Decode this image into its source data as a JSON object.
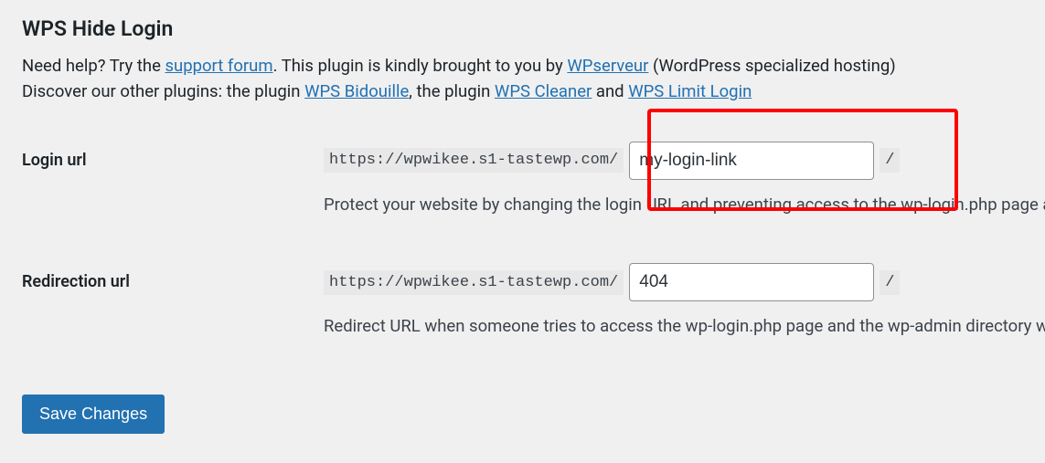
{
  "heading": "WPS Hide Login",
  "intro": {
    "help_prefix": "Need help? Try the ",
    "support_forum": "support forum",
    "brought_by_prefix": ". This plugin is kindly brought to you by ",
    "wpserveur": "WPserveur",
    "wpserveur_suffix": " (WordPress specialized hosting)",
    "discover_prefix": "Discover our other plugins: the plugin ",
    "wps_bidouille": "WPS Bidouille",
    "the_plugin": ", the plugin ",
    "wps_cleaner": "WPS Cleaner",
    "and": " and ",
    "wps_limit_login": "WPS Limit Login"
  },
  "login": {
    "label": "Login url",
    "base_url": "https://wpwikee.s1-tastewp.com/",
    "value": "my-login-link",
    "trailing_slash": "/",
    "description": "Protect your website by changing the login URL and preventing access to the wp-login.php page and the wp-admin directory to non-connected people."
  },
  "redirection": {
    "label": "Redirection url",
    "base_url": "https://wpwikee.s1-tastewp.com/",
    "value": "404",
    "trailing_slash": "/",
    "description": "Redirect URL when someone tries to access the wp-login.php page and the wp-admin directory while not logged in."
  },
  "submit": {
    "label": "Save Changes"
  }
}
